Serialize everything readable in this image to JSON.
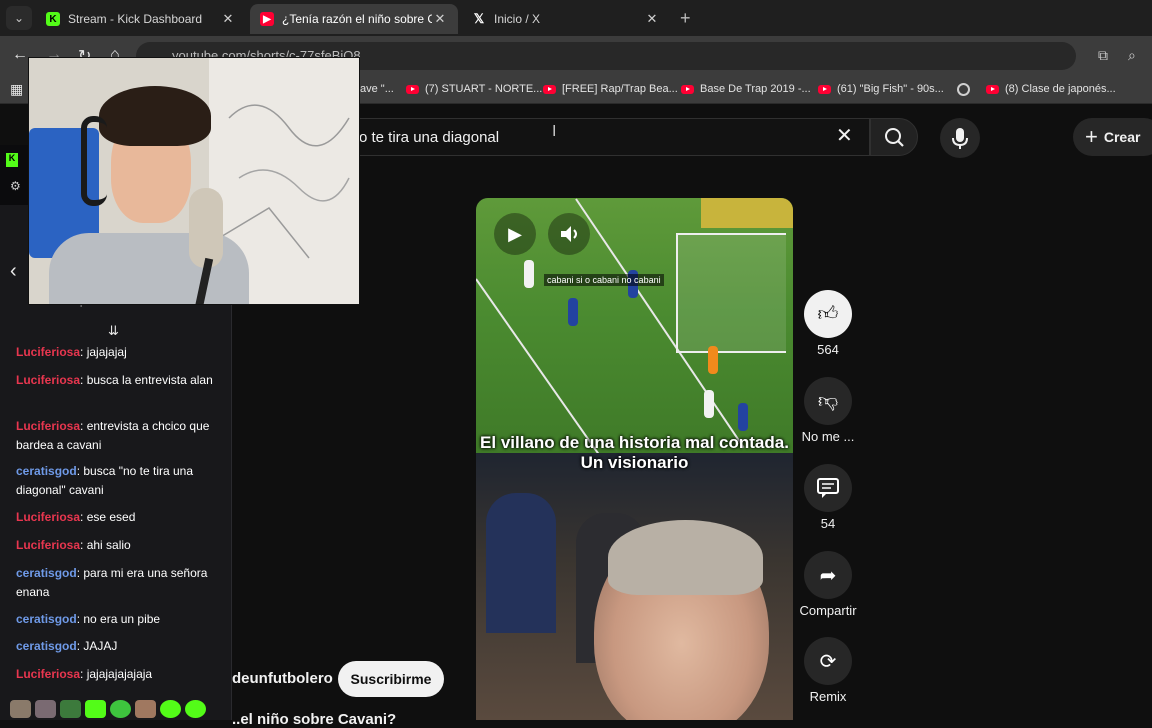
{
  "browser": {
    "tabs": [
      {
        "title": "Stream - Kick Dashboard",
        "favicon": "kick-icon",
        "active": false
      },
      {
        "title": "¿Tenía razón el niño sobre Cavani",
        "favicon": "youtube-icon",
        "active": true
      },
      {
        "title": "Inicio / X",
        "favicon": "x-icon",
        "active": false
      }
    ],
    "url": "youtube.com/shorts/c-77sfeBiQ8",
    "bookmarks": [
      {
        "label": "ave \"...",
        "icon": "none"
      },
      {
        "label": "(7) STUART - NORTE...",
        "icon": "youtube-icon"
      },
      {
        "label": "[FREE] Rap/Trap Bea...",
        "icon": "youtube-icon"
      },
      {
        "label": "Base De Trap 2019 -...",
        "icon": "youtube-icon"
      },
      {
        "label": "(61) \"Big Fish\" - 90s...",
        "icon": "youtube-icon"
      },
      {
        "label": "",
        "icon": "globe-icon"
      },
      {
        "label": "(8) Clase de japonés...",
        "icon": "youtube-icon"
      }
    ]
  },
  "youtube": {
    "search_query": "o te tira una diagonal",
    "create_label": "Crear",
    "video": {
      "overlay_caption": "cabani si o cabani no cabani",
      "title_caption": "El villano de una historia mal contada. Un visionario"
    },
    "actions": {
      "like_count": "564",
      "dislike_label": "No me ...",
      "comments_count": "54",
      "share_label": "Compartir",
      "remix_label": "Remix"
    },
    "channel_name": "deunfutbolero",
    "subscribe_label": "Suscribirme",
    "next_title_partial": "..el niño sobre Cavani?"
  },
  "kick_chat": {
    "position_label": "posición 1",
    "messages": [
      {
        "user": "Luciferiosa",
        "text": "jajajajaj",
        "color": "#e8364f"
      },
      {
        "user": "Luciferiosa",
        "text": "busca la entrevista alan",
        "color": "#e8364f"
      },
      {
        "user": "Luciferiosa",
        "text": "entrevista a chcico que bardea a cavani",
        "color": "#e8364f"
      },
      {
        "user": "ceratisgod",
        "text": "busca \"no te tira una diagonal\" cavani",
        "color": "#6f9ae8"
      },
      {
        "user": "Luciferiosa",
        "text": "ese esed",
        "color": "#e8364f"
      },
      {
        "user": "Luciferiosa",
        "text": "ahi salio",
        "color": "#e8364f"
      },
      {
        "user": "ceratisgod",
        "text": "para mi era una señora enana",
        "color": "#6f9ae8"
      },
      {
        "user": "ceratisgod",
        "text": "no era un pibe",
        "color": "#6f9ae8"
      },
      {
        "user": "ceratisgod",
        "text": "JAJAJ",
        "color": "#6f9ae8"
      },
      {
        "user": "Luciferiosa",
        "text": "jajajajajajaja",
        "color": "#e8364f"
      }
    ]
  }
}
